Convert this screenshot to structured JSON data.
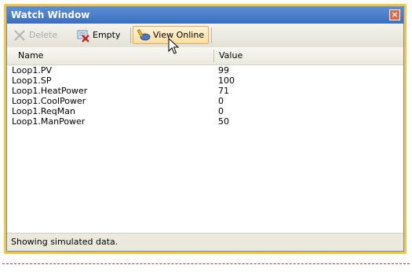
{
  "window": {
    "title": "Watch Window",
    "close_glyph": "×"
  },
  "toolbar": {
    "delete_label": "Delete",
    "empty_label": "Empty",
    "view_online_label": "View Online"
  },
  "table": {
    "columns": [
      "Name",
      "Value"
    ],
    "rows": [
      {
        "name": "Loop1.PV",
        "value": "99"
      },
      {
        "name": "Loop1.SP",
        "value": "100"
      },
      {
        "name": "Loop1.HeatPower",
        "value": "71"
      },
      {
        "name": "Loop1.CoolPower",
        "value": "0"
      },
      {
        "name": "Loop1.ReqMan",
        "value": "0"
      },
      {
        "name": "Loop1.ManPower",
        "value": "50"
      }
    ]
  },
  "status": {
    "text": "Showing simulated data."
  },
  "colors": {
    "frame_accent": "#f5c542",
    "titlebar": "#3c6fc0",
    "active_button": "#fbdfa1"
  },
  "icons": {
    "delete": "x-icon",
    "empty": "empty-icon",
    "view_online": "view-online-icon",
    "cursor": "mouse-pointer-icon"
  }
}
